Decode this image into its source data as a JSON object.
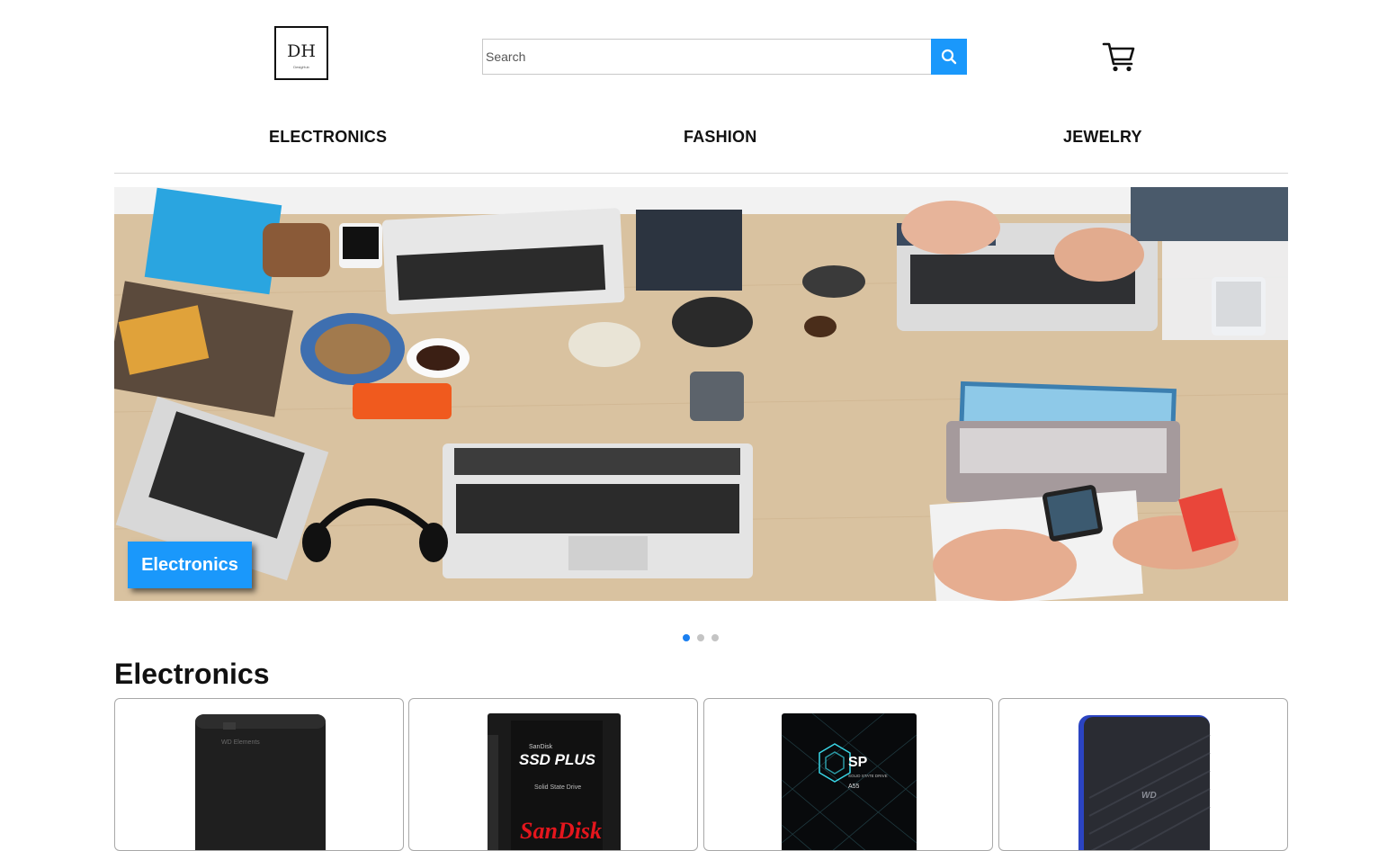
{
  "header": {
    "logo": {
      "monogram": "DH",
      "tagline": "DesigHub"
    },
    "search": {
      "placeholder": "Search",
      "value": "",
      "button_icon": "search-icon"
    },
    "cart_icon": "cart-icon"
  },
  "nav": {
    "items": [
      {
        "label": "ELECTRONICS"
      },
      {
        "label": "FASHION"
      },
      {
        "label": "JEWELRY"
      }
    ]
  },
  "carousel": {
    "slide_label": "Electronics",
    "slide_count": 3,
    "active_index": 0
  },
  "section": {
    "title": "Electronics",
    "products": [
      {
        "image": "wd-elements-external-drive",
        "brand_text": "WD Elements"
      },
      {
        "image": "sandisk-ssd-plus",
        "line1": "SanDisk",
        "line2": "SSD PLUS",
        "line3": "Solid State Drive",
        "brand": "SanDisk"
      },
      {
        "image": "silicon-power-a55-ssd",
        "logo": "SP",
        "line1": "SOLID STATE DRIVE",
        "model": "A55"
      },
      {
        "image": "wd-gaming-drive",
        "logo": "WD"
      }
    ]
  },
  "colors": {
    "accent": "#1a98fb",
    "dot_active": "#1a7ff0",
    "dot_inactive": "#c4c4c4"
  }
}
